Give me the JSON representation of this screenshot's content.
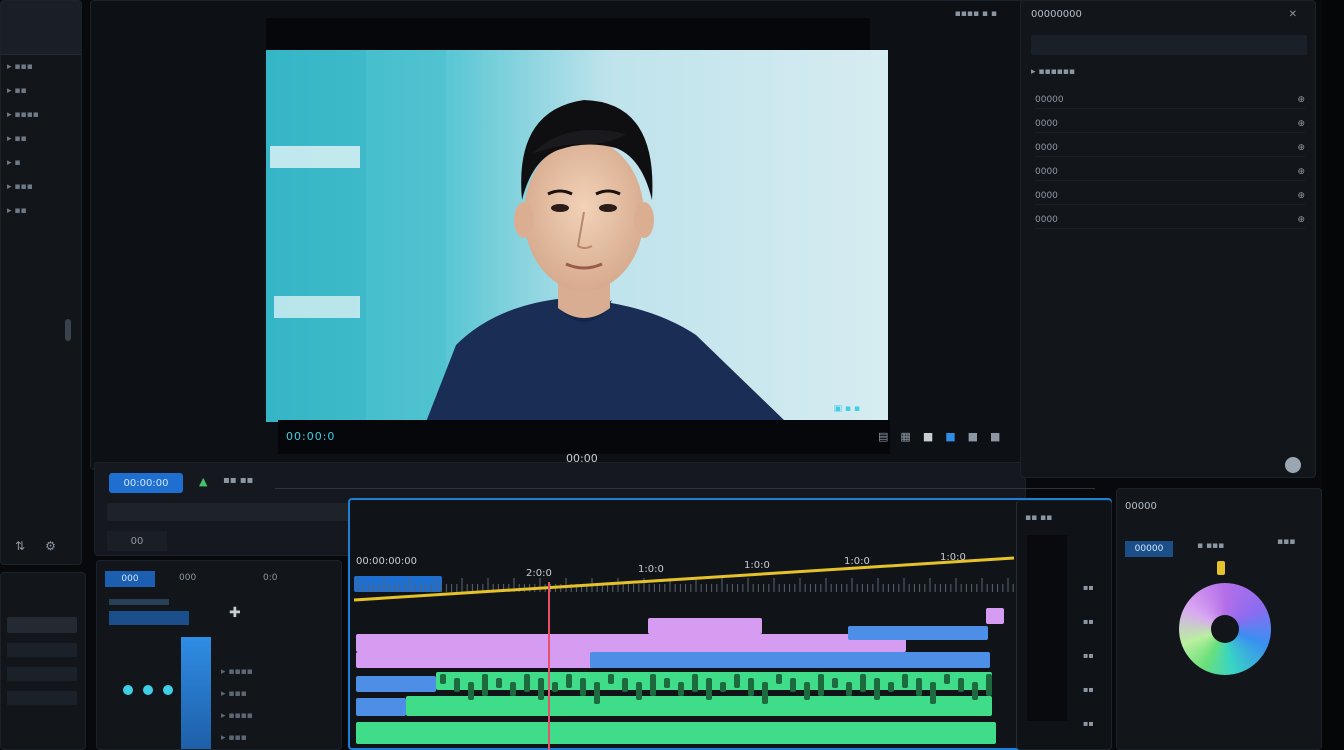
{
  "viewer": {
    "timecode_left": "00:00:0",
    "timecode_center": "00:00 ",
    "timecode_right": "00:00:00"
  },
  "transport": {
    "zoom_label": "00:00:00",
    "page_label": "00"
  },
  "timeline": {
    "title": "00:00:00:00",
    "ruler_ticks": [
      "2:0:0",
      "1:0:0",
      "1:0:0",
      "1:0:0",
      "1:0:0"
    ],
    "colors": {
      "playhead": "#e8506a",
      "accent": "#1e7fd6",
      "yellow_track": "#e6c22a",
      "clip_pink": "#d59cf2",
      "clip_blue": "#4d8fe6",
      "clip_green": "#3fdc8a"
    }
  },
  "bins": {
    "tab_active": "000",
    "tab_2": "000",
    "tab_3": "0:0"
  },
  "inspector": {
    "title": "00000000",
    "rows": [
      "00000",
      "0000",
      "0000",
      "0000",
      "0000",
      "0000"
    ]
  },
  "color_panel": {
    "title": "00000",
    "chip_label": "00000"
  },
  "icons": [
    "play-icon",
    "cut-icon",
    "magnet-icon",
    "link-icon",
    "marker-icon",
    "settings-icon"
  ]
}
